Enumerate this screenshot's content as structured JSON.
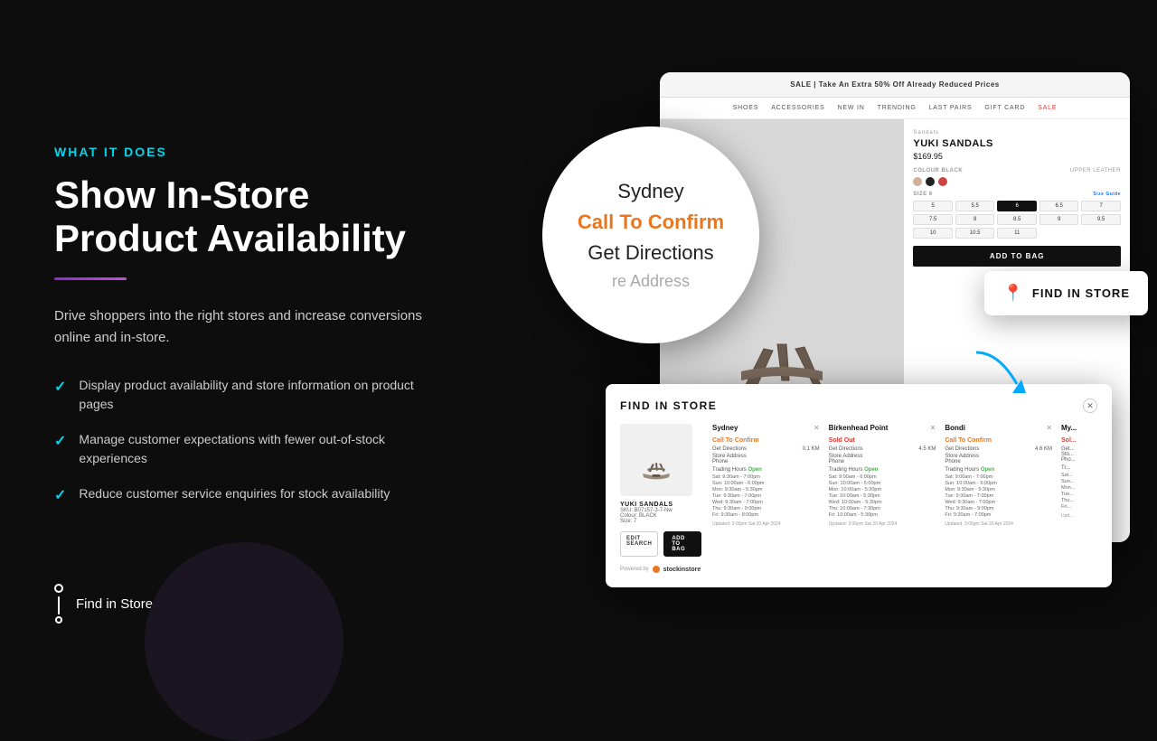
{
  "label": {
    "what_it_does": "WHAT IT DOES",
    "heading_line1": "Show In-Store",
    "heading_line2": "Product Availability"
  },
  "description": "Drive shoppers into the right stores and increase conversions online and in-store.",
  "checklist": [
    "Display product availability and store information on product pages",
    "Manage customer expectations with fewer out-of-stock experiences",
    "Reduce customer service enquiries for stock availability"
  ],
  "bottom_logo": {
    "text": "Find in Store by stockinstore"
  },
  "mockup": {
    "topbar": "SALE | Take An Extra 50% Off Already Reduced Prices",
    "nav_items": [
      "SHOES",
      "ACCESSORIES",
      "NEW IN",
      "TRENDING",
      "LAST PAIRS",
      "GIFT CARD",
      "SALE"
    ],
    "product_title": "YUKI SANDALS",
    "product_price": "$169.95",
    "colour_label": "COLOUR",
    "colour_value": "BLACK",
    "upper_label": "UPPER",
    "upper_value": "LEATHER",
    "size_label": "SIZE",
    "size_guide": "Size Guide",
    "sizes": [
      "5",
      "5.5",
      "6",
      "6.5",
      "7",
      "7.5",
      "8",
      "8.5",
      "9",
      "9.5",
      "10",
      "10.5",
      "11"
    ],
    "selected_size": "6",
    "add_to_bag": "ADD TO BAG"
  },
  "find_in_store_btn": {
    "text": "FIND IN STORE"
  },
  "popup": {
    "city": "Sydney",
    "status": "Call To Confirm",
    "action": "Get Directions",
    "address": "re Address"
  },
  "modal": {
    "title": "FIND IN STORE",
    "product": {
      "name": "YUKI SANDALS",
      "sku": "SKU: B07157-3-7-Nw",
      "colour": "Colour: BLACK",
      "size": "Size: 7",
      "edit_btn": "EDIT SEARCH",
      "add_btn": "ADD TO BAG"
    },
    "stores": [
      {
        "name": "Sydney",
        "status": "Call To Confirm",
        "status_type": "call",
        "distance": "0.1 KM",
        "directions": "Get Directions",
        "address": "Store Address",
        "phone": "Phone",
        "hours_label": "Trading Hours",
        "open_label": "Open",
        "hours": [
          "Sat:  9:30am - 7:00pm",
          "Sun: 10:00am - 6:00pm",
          "Mon: 9:30am - 5:30pm",
          "Tue:  9:30am - 7:00pm",
          "Wed: 9:30am - 7:00pm",
          "Thu:  9:30am - 9:00pm",
          "Fri:  9:30am - 8:00pm"
        ],
        "updated": "Updated: 3:00pm Sat 20 Apr 2024"
      },
      {
        "name": "Birkenhead Point",
        "status": "Sold Out",
        "status_type": "sold",
        "distance": "4.5 KM",
        "directions": "Get Directions",
        "address": "Store Address",
        "phone": "Phone",
        "hours_label": "Trading Hours",
        "open_label": "Open",
        "hours": [
          "Sat:  9:00am - 6:00pm",
          "Sun: 10:00am - 5:00pm",
          "Mon: 10:00am - 5:30pm",
          "Tue:  10:00am - 5:30pm",
          "Wed: 10:00am - 5:30pm",
          "Thu:  10:00am - 7:30pm",
          "Fri:  10:00am - 5:30pm"
        ],
        "updated": "Updated: 3:00pm Sat 20 Apr 2024"
      },
      {
        "name": "Bondi",
        "status": "Call To Confirm",
        "status_type": "call",
        "distance": "4.6 KM",
        "directions": "Get Directions",
        "address": "Store Address",
        "phone": "Phone",
        "hours_label": "Trading Hours",
        "open_label": "Open",
        "hours": [
          "Sat:  9:00am - 7:00pm",
          "Sun: 10:00am - 6:00pm",
          "Mon: 9:30am - 5:30pm",
          "Tue:  9:30am - 7:00pm",
          "Wed: 9:30am - 7:00pm",
          "Thu:  9:30am - 9:00pm",
          "Fri:  9:30am - 7:00pm"
        ],
        "updated": "Updated: 3:00pm Sat 20 Apr 2024"
      },
      {
        "name": "My...",
        "status": "Sol...",
        "status_type": "sold",
        "distance": "",
        "directions": "Get...",
        "address": "Sto...",
        "phone": "Pho...",
        "hours_label": "Tr...",
        "open_label": "",
        "hours": [
          "Sat...",
          "Sun...",
          "Mon...",
          "Tue...",
          "Thu...",
          "Fri..."
        ],
        "updated": "Upd..."
      }
    ],
    "powered_by": "Powered by",
    "logo": "stockinstore"
  }
}
